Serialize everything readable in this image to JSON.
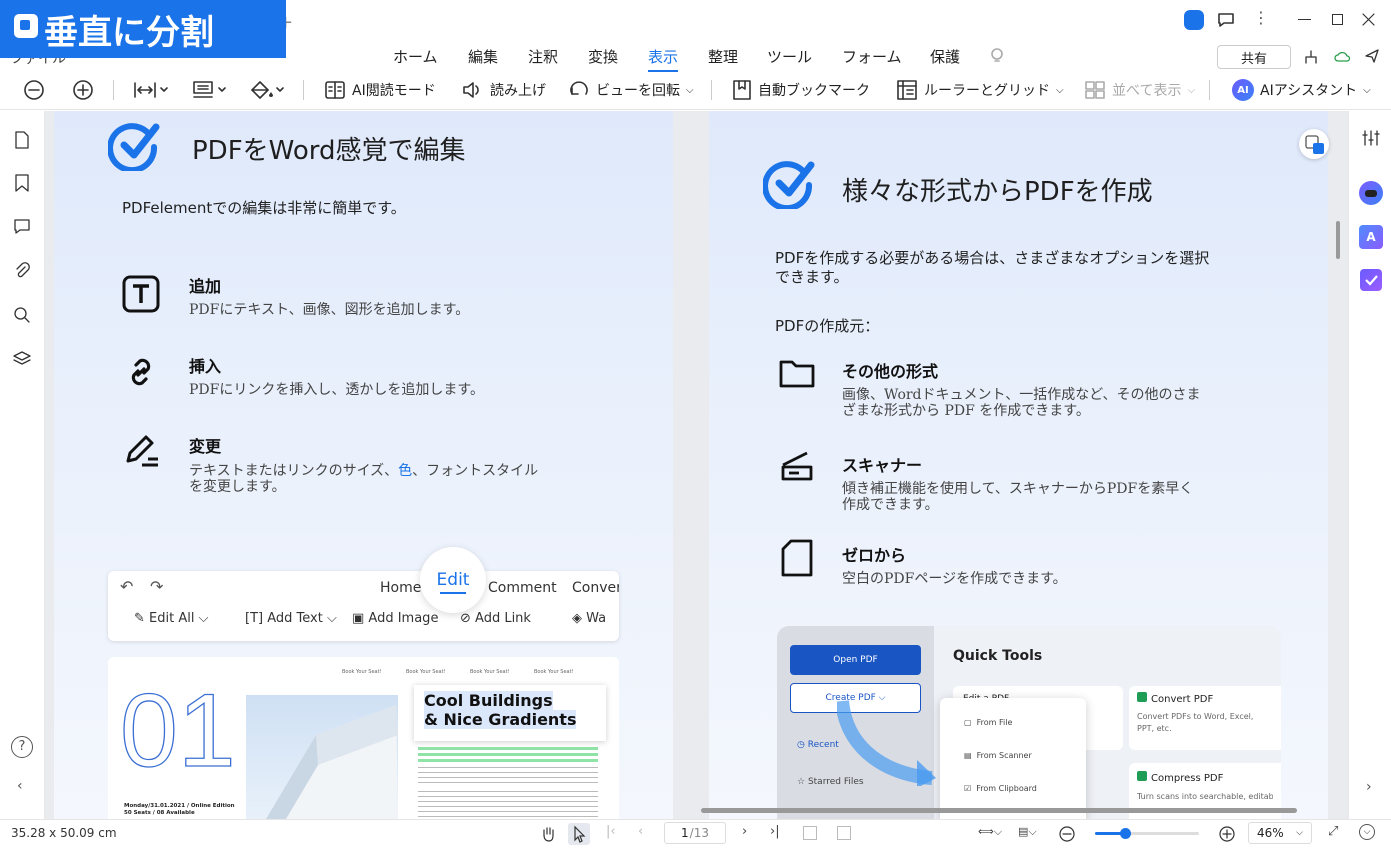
{
  "badge": {
    "text": "垂直に分割"
  },
  "menu": {
    "file": "ファイル",
    "tabs": [
      "ホーム",
      "編集",
      "注釈",
      "変換",
      "表示",
      "整理",
      "ツール",
      "フォーム",
      "保護"
    ],
    "share": "共有"
  },
  "toolbar": {
    "ai_reading": "AI閲読モード",
    "read_aloud": "読み上げ",
    "rotate_view": "ビューを回転",
    "auto_bookmark": "自動ブックマーク",
    "ruler_grid": "ルーラーとグリッド",
    "side_by_side": "並べて表示",
    "ai_assistant": "AIアシスタント",
    "ai_badge": "AI"
  },
  "left_page": {
    "title": "PDFをWord感覚で編集",
    "intro": "PDFelementでの編集は非常に簡単です。",
    "items": [
      {
        "head": "追加",
        "text": "PDFにテキスト、画像、図形を追加します。"
      },
      {
        "head": "挿入",
        "text": "PDFにリンクを挿入し、透かしを追加します。"
      },
      {
        "head": "変更",
        "text1": "テキストまたはリンクのサイズ、",
        "text_color": "色",
        "text2": "、フォントスタイル",
        "text3": "を変更します。"
      }
    ],
    "mock_tabs": {
      "home": "Home",
      "edit": "Edit",
      "comment": "Comment",
      "convert": "Convert"
    },
    "mock_tools": [
      "Edit All",
      "Add Text",
      "Add Image",
      "Add Link",
      "Wa"
    ],
    "mock_doc": {
      "big": "01",
      "heading1": "Cool Buildings",
      "heading2": "& Nice Gradients",
      "top_labels": [
        "Book Your Seat!",
        "Book Your Seat!",
        "Book Your Seat!",
        "Book Your Seat!"
      ],
      "footer1": "Monday/31.01.2021 / Online Edition",
      "footer2": "50 Seats / 08 Available"
    }
  },
  "right_page": {
    "title": "様々な形式からPDFを作成",
    "intro1": "PDFを作成する必要がある場合は、さまざまなオプションを選択",
    "intro2": "できます。",
    "source_label": "PDFの作成元：",
    "items": [
      {
        "head": "その他の形式",
        "text1": "画像、Wordドキュメント、一括作成など、その他のさま",
        "text2": "ざまな形式から PDF を作成できます。"
      },
      {
        "head": "スキャナー",
        "text1": "傾き補正機能を使用して、スキャナーからPDFを素早く",
        "text2": "作成できます。"
      },
      {
        "head": "ゼロから",
        "text1": "空白のPDFページを作成できます。"
      }
    ],
    "mock": {
      "open_pdf": "Open PDF",
      "create_pdf": "Create PDF",
      "recent": "Recent",
      "starred": "Starred Files",
      "quick_tools": "Quick Tools",
      "edit_pdf": "Edit a PDF",
      "convert_pdf": "Convert PDF",
      "convert_desc": "Convert PDFs to Word, Excel, PPT, etc.",
      "compress_pdf": "Compress PDF",
      "compress_desc": "Turn scans into searchable, editab",
      "menu": [
        "From File",
        "From Scanner",
        "From Clipboard"
      ]
    }
  },
  "status": {
    "size": "35.28 x 50.09 cm",
    "page": "1",
    "total": "/13",
    "zoom": "46%"
  },
  "colors": {
    "accent": "#1a73e8",
    "badge": "#1a73e8"
  }
}
